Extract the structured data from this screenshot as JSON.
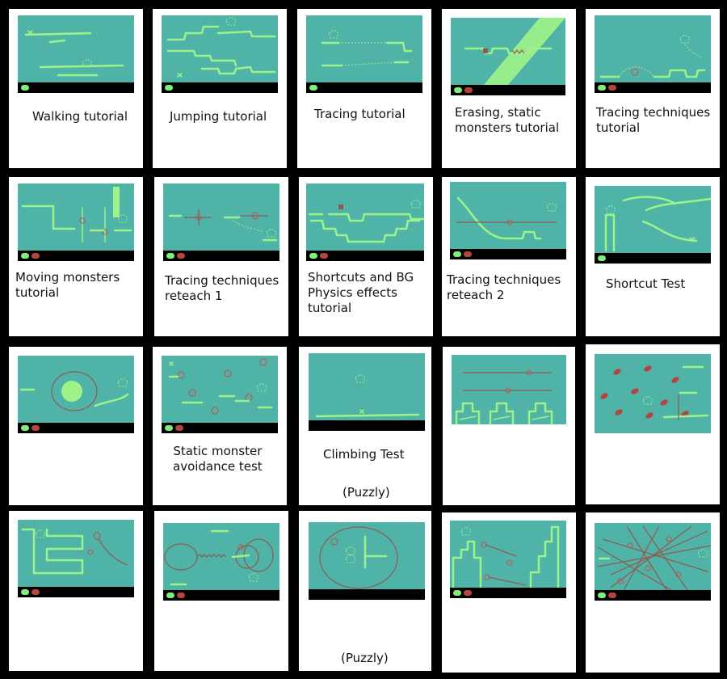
{
  "levels": [
    {
      "title": "Walking tutorial"
    },
    {
      "title": "Jumping tutorial"
    },
    {
      "title": "Tracing tutorial"
    },
    {
      "title": "Erasing, static\nmonsters tutorial"
    },
    {
      "title": "Tracing techniques\ntutorial"
    },
    {
      "title": "Moving monsters\ntutorial"
    },
    {
      "title": "Tracing techniques\nreteach 1"
    },
    {
      "title": "Shortcuts and BG\nPhysics effects\ntutorial"
    },
    {
      "title": "Tracing techniques\nreteach 2"
    },
    {
      "title": "Shortcut Test"
    },
    {
      "title": ""
    },
    {
      "title": "Static monster\navoidance test"
    },
    {
      "title": "Climbing Test",
      "note": "(Puzzly)"
    },
    {
      "title": ""
    },
    {
      "title": ""
    },
    {
      "title": ""
    },
    {
      "title": ""
    },
    {
      "title": "",
      "note": "(Puzzly)"
    },
    {
      "title": ""
    },
    {
      "title": ""
    }
  ],
  "colors": {
    "background": "#000000",
    "card": "#ffffff",
    "screen": "#4fb3a7",
    "platform": "#9ef28a",
    "monster": "#b3443f",
    "hud_green": "#7ef07a"
  }
}
